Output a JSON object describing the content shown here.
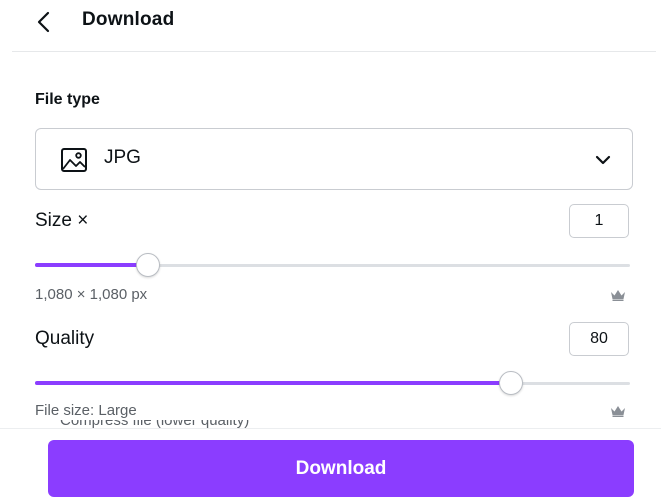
{
  "header": {
    "title": "Download",
    "back_icon": "chevron-left-icon"
  },
  "file_type": {
    "label": "File type",
    "selected": "JPG",
    "icon": "image-icon",
    "dropdown_icon": "chevron-down-icon"
  },
  "size": {
    "label": "Size ×",
    "value": "1",
    "slider_fraction": 0.19,
    "info": "1,080 × 1,080 px",
    "premium_icon": "crown-icon"
  },
  "quality": {
    "label": "Quality",
    "value": "80",
    "slider_fraction": 0.8,
    "info": "File size: Large",
    "premium_icon": "crown-icon"
  },
  "clipped_option_text": "Compress file (lower quality)",
  "download_button": {
    "label": "Download"
  },
  "colors": {
    "accent": "#8b3dff",
    "track": "#dcdfe3",
    "text": "#0d1216",
    "muted": "#5b6066"
  }
}
